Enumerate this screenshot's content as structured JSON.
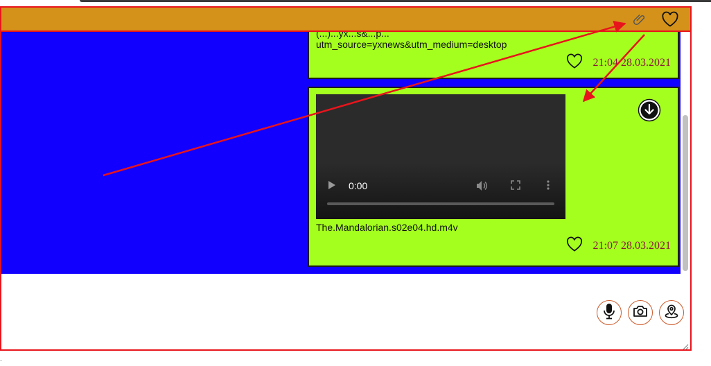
{
  "messages": [
    {
      "url_line1": "(...)...yx...s&...p...",
      "url_line2": "utm_source=yxnews&utm_medium=desktop",
      "time": "21:04 28.03.2021"
    },
    {
      "video_time": "0:00",
      "filename": "The.Mandalorian.s02e04.hd.m4v",
      "time": "21:07 28.03.2021"
    }
  ],
  "icons": {
    "attach": "paperclip-icon",
    "favorites": "heart-icon",
    "download": "download-circle-icon",
    "mic": "microphone-icon",
    "camera": "camera-icon",
    "location": "map-pin-icon"
  },
  "colors": {
    "header": "#d4921a",
    "chat_background": "#1200ff",
    "message_bubble": "#a4ff1e",
    "timestamp": "#8a1a3c",
    "annotation": "#e8141c"
  },
  "footer_mark": "."
}
